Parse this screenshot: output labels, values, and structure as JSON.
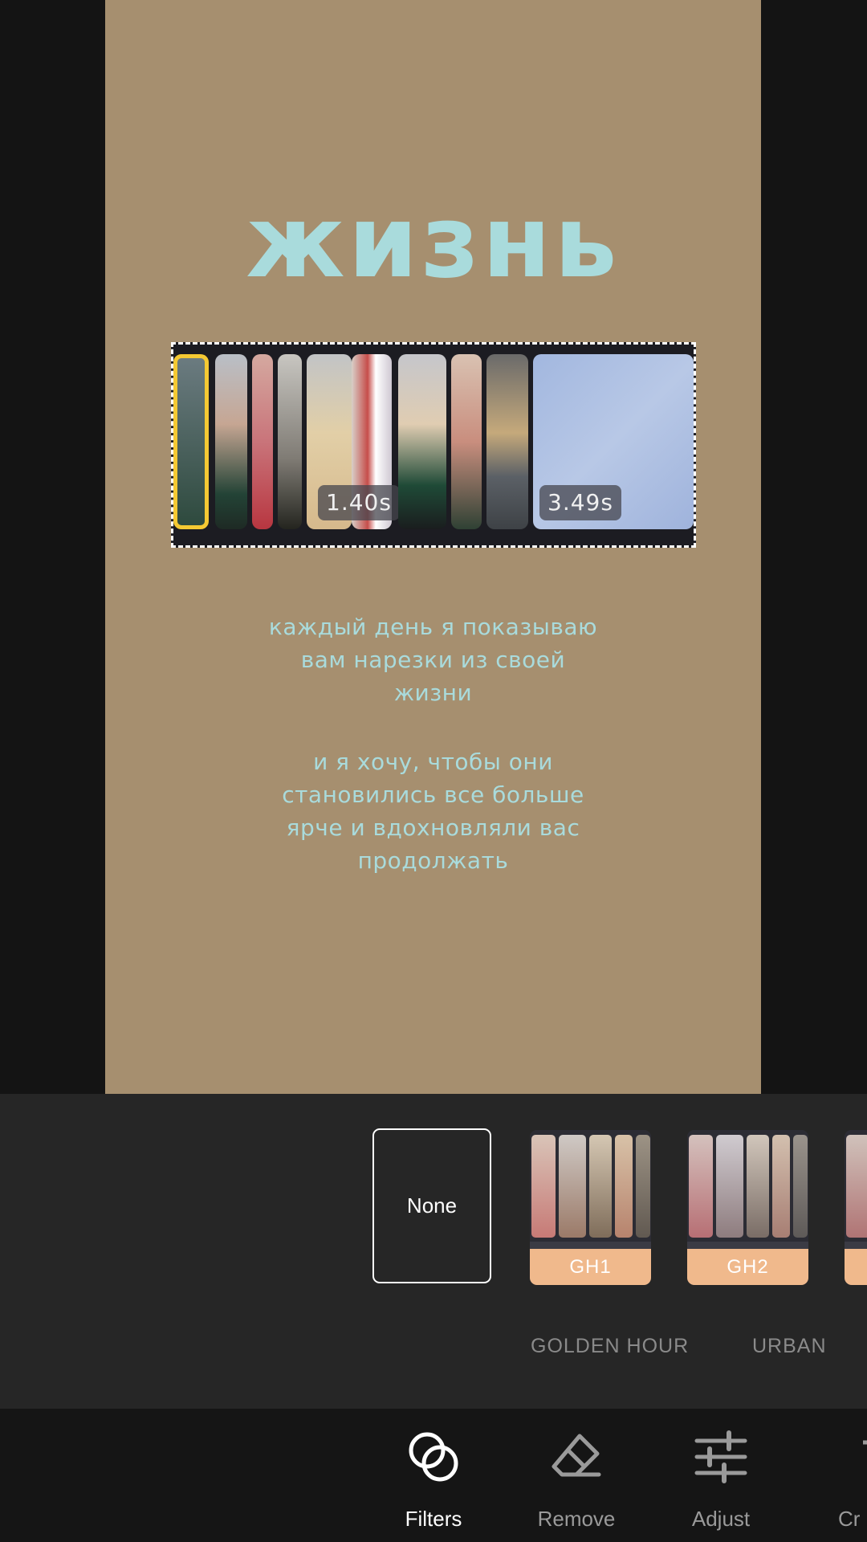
{
  "canvas": {
    "title": "жизнь",
    "caption_lines_1": [
      "каждый день я показываю",
      "вам нарезки из своей",
      "жизни"
    ],
    "caption_lines_2": [
      "и я хочу, чтобы они",
      "становились все больше",
      "ярче и вдохновляли вас",
      "продолжать"
    ],
    "clip_durations": [
      "1.40s",
      "3.49s"
    ],
    "colors": {
      "background": "#a68f6f",
      "text": "#a9dbdc",
      "selected_clip": "#f5c933"
    }
  },
  "filters": {
    "none_label": "None",
    "items": [
      {
        "label": "GH1"
      },
      {
        "label": "GH2"
      }
    ],
    "groups": [
      "GOLDEN HOUR",
      "URBAN"
    ],
    "accent": "#f0b98c"
  },
  "toolbar": {
    "items": [
      {
        "label": "Filters",
        "icon": "filters-icon",
        "active": true
      },
      {
        "label": "Remove",
        "icon": "eraser-icon",
        "active": false
      },
      {
        "label": "Adjust",
        "icon": "sliders-icon",
        "active": false
      },
      {
        "label": "Cr",
        "icon": "crop-icon",
        "active": false
      }
    ]
  }
}
